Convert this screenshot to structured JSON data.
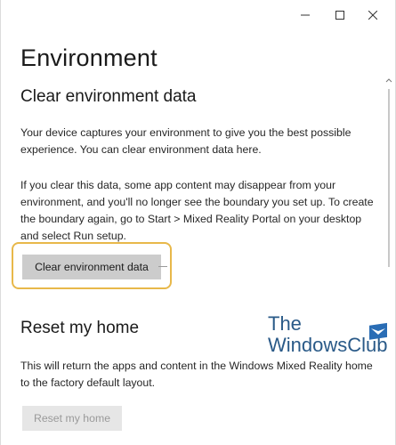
{
  "window": {
    "controls": {
      "minimize_icon": "minimize-icon",
      "maximize_icon": "maximize-icon",
      "close_icon": "close-icon"
    }
  },
  "page": {
    "title": "Environment"
  },
  "sections": {
    "clear": {
      "title": "Clear environment data",
      "para1": "Your device captures your environment to give you the best possible experience. You can clear environment data here.",
      "para2": "If you clear this data, some app content may disappear from your environment, and you'll no longer see the boundary you set up. To create the boundary again, go to Start > Mixed Reality Portal on your desktop and select Run setup.",
      "button_label": "Clear environment data"
    },
    "reset": {
      "title": "Reset my home",
      "para": "This will return the apps and content in the Windows Mixed Reality home to the factory default layout.",
      "button_label": "Reset my home"
    }
  },
  "watermark": {
    "line1": "The",
    "line2": "WindowsClub"
  },
  "colors": {
    "highlight_border": "#e8b84a",
    "button_bg": "#cccccc",
    "disabled_button_bg": "#e6e6e6",
    "watermark_text": "#2a5a88"
  }
}
